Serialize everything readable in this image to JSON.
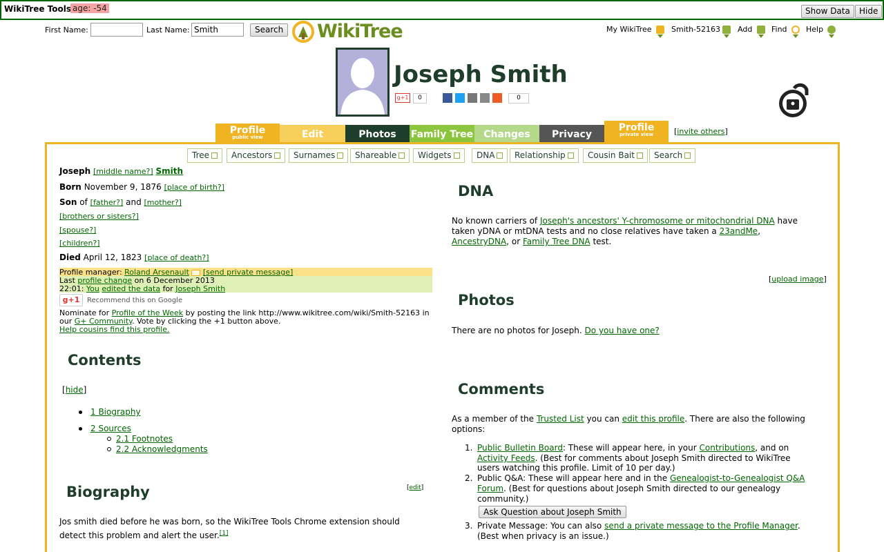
{
  "tools_bar": {
    "title": "WikiTree Tools:",
    "age_badge": "age: -54",
    "show_data_label": "Show Data",
    "hide_label": "Hide"
  },
  "header": {
    "first_name_label": "First Name:",
    "first_name_value": "",
    "last_name_label": "Last Name:",
    "last_name_value": "Smith",
    "search_label": "Search",
    "logo_text": "WikiTree",
    "nav": {
      "my_wikitree": "My WikiTree",
      "user_id": "Smith-52163",
      "add": "Add",
      "find": "Find",
      "help": "Help"
    }
  },
  "profile": {
    "name": "Joseph Smith",
    "gplus_label": "g+1",
    "gplus_count": "0",
    "share_count": "0"
  },
  "tabs": [
    {
      "label": "Profile",
      "sub": "public view"
    },
    {
      "label": "Edit"
    },
    {
      "label": "Photos"
    },
    {
      "label": "Family Tree"
    },
    {
      "label": "Changes"
    },
    {
      "label": "Privacy"
    },
    {
      "label": "Profile",
      "sub": "private view"
    }
  ],
  "invite_others": "invite others",
  "subtabs": [
    "Tree",
    "Ancestors",
    "Surnames",
    "Shareable",
    "Widgets",
    "DNA",
    "Relationship",
    "Cousin Bait",
    "Search"
  ],
  "vitals": {
    "first_name": "Joseph",
    "middle_name_link": "[middle name?]",
    "last_name": "Smith",
    "born_label": "Born",
    "born_date": "November 9, 1876",
    "place_of_birth_link": "[place of birth?]",
    "son_label": "Son",
    "of_text": "of",
    "father_link": "[father?]",
    "and_text": "and",
    "mother_link": "[mother?]",
    "siblings_link": "[brothers or sisters?]",
    "spouse_link": "[spouse?]",
    "children_link": "[children?]",
    "died_label": "Died",
    "died_date": "April 12, 1823",
    "place_of_death_link": "[place of death?]"
  },
  "manager": {
    "label": "Profile manager:",
    "name": "Roland Arsenault",
    "send_message": "[send private message]",
    "last_prefix": "Last",
    "profile_change": "profile change",
    "change_date": "on 6 December 2013",
    "change_time": "22:01:",
    "you": "You",
    "edited": "edited the data",
    "for_text": "for",
    "subject": "Joseph Smith"
  },
  "recommend": {
    "gplus": "g+1",
    "text": "Recommend this on Google",
    "nominate_prefix": "Nominate for",
    "potw": "Profile of the Week",
    "nominate_mid": "by posting the link http://www.wikitree.com/wiki/Smith-52163 in",
    "our": "our",
    "community": "G+ Community",
    "vote": ". Vote by clicking the +1 button above.",
    "help_cousins": "Help cousins find this profile."
  },
  "contents": {
    "title": "Contents",
    "hide": "hide",
    "items": [
      "1 Biography",
      "2 Sources",
      "2.1 Footnotes",
      "2.2 Acknowledgments"
    ]
  },
  "biography": {
    "title": "Biography",
    "edit": "edit",
    "line1": "Jos smith died before he was born, so the WikiTree Tools Chrome extension should",
    "line2": "detect this problem and alert the user.",
    "footnote": "[1]"
  },
  "dna": {
    "title": "DNA",
    "l1a": "No known carriers of",
    "l1link": "Joseph's ancestors' Y-chromosome or mitochondrial DNA",
    "l1b": "have",
    "l2a": "taken yDNA or mtDNA tests and no close relatives have taken a",
    "l2link": "23andMe",
    "l3link1": "AncestryDNA",
    "l3mid": ", or",
    "l3link2": "Family Tree DNA",
    "l3end": "test."
  },
  "upload_image": "upload image",
  "photos": {
    "title": "Photos",
    "text": "There are no photos for Joseph.",
    "link": "Do you have one?"
  },
  "comments": {
    "title": "Comments",
    "intro_a": "As a member of the",
    "trusted": "Trusted List",
    "intro_b": "you can",
    "edit_profile": "edit this profile",
    "intro_c": ". There are also the following",
    "intro_d": "options:",
    "i1_link": "Public Bulletin Board",
    "i1_a": ": These will appear here, in your",
    "i1_contrib": "Contributions",
    "i1_b": ", and on",
    "i1_feeds": "Activity Feeds",
    "i1_c": ". (Best for comments about Joseph Smith directed to WikiTree",
    "i1_d": "users watching this profile. Limit of 10 per day.)",
    "i2_a": "Public Q&A: These will appear here and in the",
    "i2_link": "Genealogist-to-Genealogist Q&A",
    "i2_link2": "Forum",
    "i2_b": ". (Best for questions about Joseph Smith directed to our genealogy",
    "i2_c": "community.)",
    "ask_button": "Ask Question about Joseph Smith",
    "i3_a": "Private Message: You can also",
    "i3_link": "send a private message to the Profile Manager",
    "i3_b": ".",
    "i3_c": "(Best when privacy is an issue.)"
  }
}
